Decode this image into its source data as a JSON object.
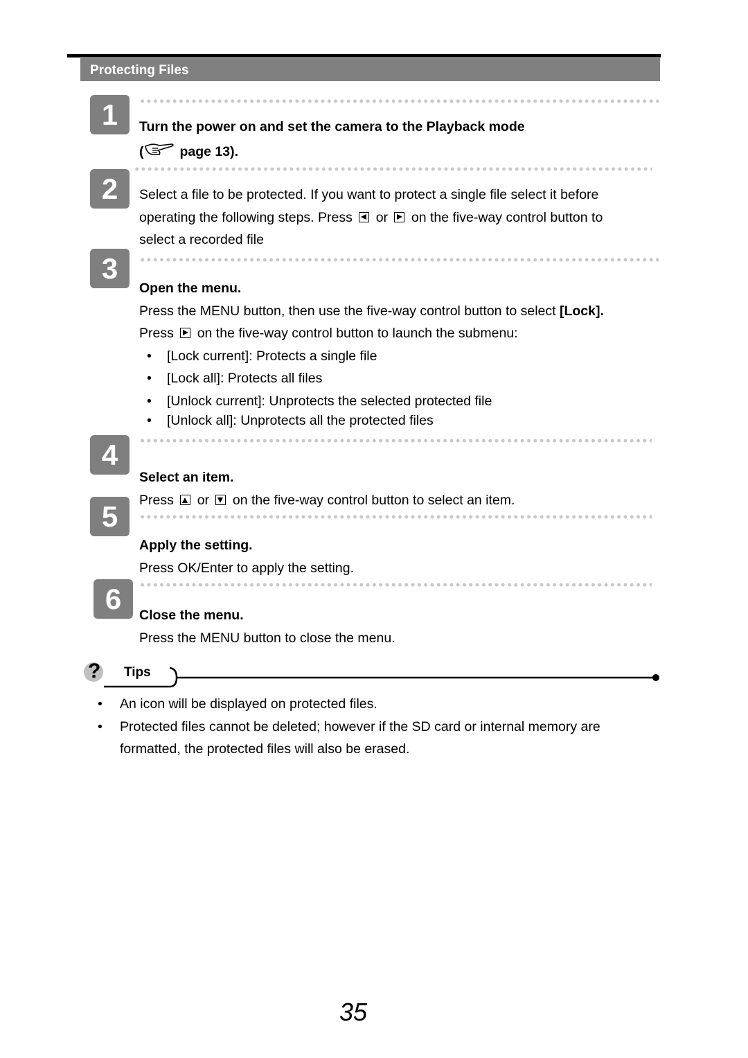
{
  "section_title": "Protecting Files",
  "steps": [
    {
      "number": "1",
      "heading": "Turn the power on and set the camera to the Playback mode",
      "ref_open": "(",
      "ref_icon": "pointing-hand-icon",
      "ref_text": "page 13)."
    },
    {
      "number": "2",
      "line1": "Select a file to be protected. If you want to protect a single file select it before",
      "line2_a": "operating the following steps. Press",
      "line2_or": "or",
      "line2_b": "on the five-way control button to",
      "line3": "select a recorded file"
    },
    {
      "number": "3",
      "heading": "Open the menu.",
      "line1_a": "Press the MENU button, then use the five-way control button to select",
      "line1_bold": "[Lock].",
      "line2_a": "Press",
      "line2_b": "on the five-way control button to launch the submenu:",
      "bullets": [
        "[Lock current]: Protects a single file",
        "[Lock all]: Protects all files",
        "[Unlock current]: Unprotects the selected protected file",
        "[Unlock all]: Unprotects all the protected files"
      ]
    },
    {
      "number": "4",
      "heading": "Select an item.",
      "line1_a": "Press",
      "line1_or": "or",
      "line1_b": "on the five-way control button to select an item."
    },
    {
      "number": "5",
      "heading": "Apply the setting.",
      "line1": "Press OK/Enter to apply the setting."
    },
    {
      "number": "6",
      "heading": "Close the menu.",
      "line1": "Press the MENU button to close the menu."
    }
  ],
  "tips": {
    "label": "Tips",
    "icon": "question-mark-icon",
    "items": [
      "An icon will be displayed on protected files.",
      "Protected files cannot be deleted; however if the SD card or internal memory are",
      "formatted, the protected files will also be erased."
    ]
  },
  "page_number": "35"
}
